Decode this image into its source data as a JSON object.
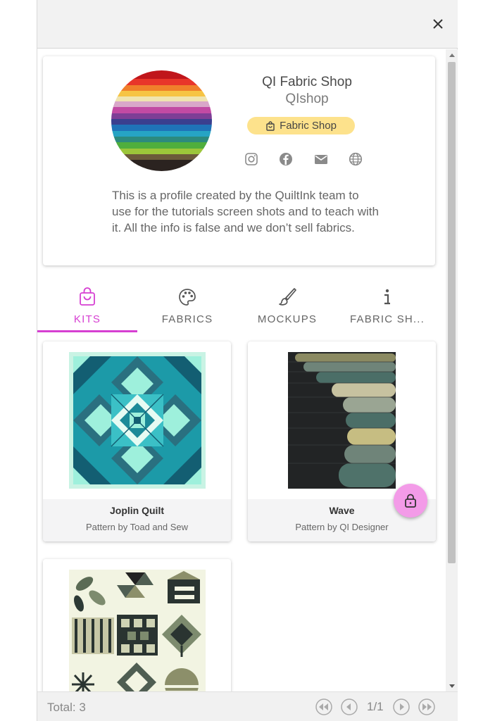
{
  "window": {
    "close_label": "×"
  },
  "profile": {
    "name": "QI Fabric Shop",
    "handle": "QIshop",
    "badge": "Fabric Shop",
    "socials": [
      "instagram-icon",
      "facebook-icon",
      "mail-icon",
      "globe-icon"
    ],
    "bio": "This is a profile created by the QuiltInk team to use for the tutorials screen shots and to teach with it. All the info is false and we don’t sell fabrics."
  },
  "tabs": [
    {
      "label": "KITS",
      "icon": "bag-icon",
      "active": true
    },
    {
      "label": "FABRICS",
      "icon": "palette-icon",
      "active": false
    },
    {
      "label": "MOCKUPS",
      "icon": "brush-icon",
      "active": false
    },
    {
      "label": "FABRIC SH...",
      "icon": "info-icon",
      "active": false
    }
  ],
  "kits": [
    {
      "title": "Joplin Quilt",
      "subtitle": "Pattern by Toad and Sew"
    },
    {
      "title": "Wave",
      "subtitle": "Pattern by QI Designer"
    },
    {
      "title": "",
      "subtitle": ""
    }
  ],
  "footer": {
    "total": "Total: 3",
    "page_info": "1/1"
  },
  "colors": {
    "accent": "#d63fd2",
    "badge": "#fde28c",
    "fab": "#f39be8"
  }
}
